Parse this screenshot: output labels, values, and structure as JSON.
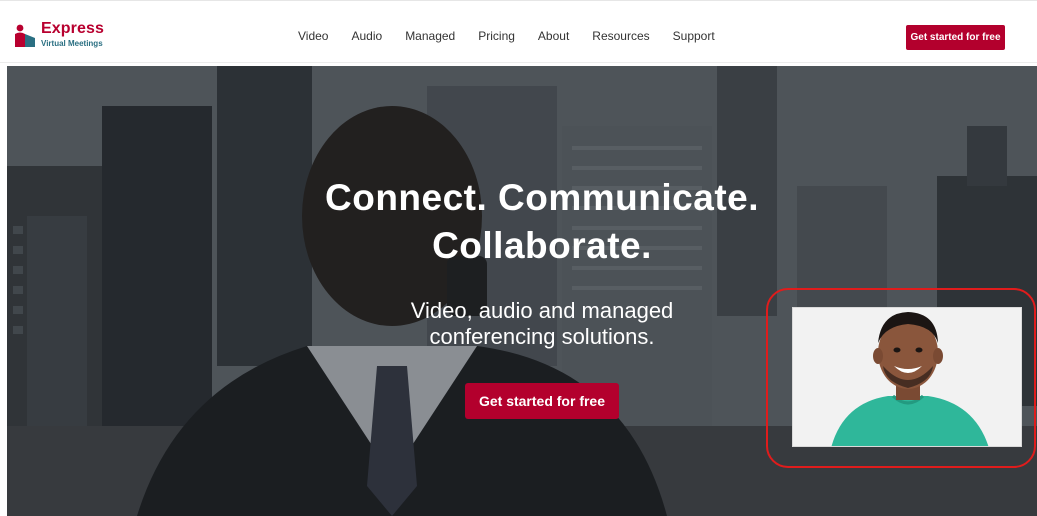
{
  "brand": {
    "name": "Express",
    "tagline": "Virtual Meetings",
    "colors": {
      "primary": "#b3002d",
      "secondary": "#2a6f82"
    },
    "logo_icon": "person-icon"
  },
  "nav": {
    "items": [
      {
        "label": "Video"
      },
      {
        "label": "Audio"
      },
      {
        "label": "Managed"
      },
      {
        "label": "Pricing"
      },
      {
        "label": "About"
      },
      {
        "label": "Resources"
      },
      {
        "label": "Support"
      }
    ],
    "cta_label": "Get started for free"
  },
  "hero": {
    "headline_line1": "Connect. Communicate.",
    "headline_line2": "Collaborate.",
    "subheadline_line1": "Video, audio and managed",
    "subheadline_line2": "conferencing solutions.",
    "cta_label": "Get started for free",
    "background": "businessman-on-phone-city-photo",
    "video_tile": "smiling-man-webcam-feed",
    "highlight_color": "#e01c1c"
  }
}
